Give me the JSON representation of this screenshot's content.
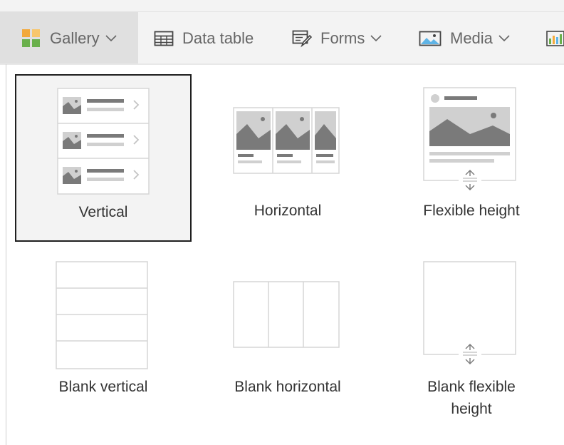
{
  "toolbar": {
    "items": [
      {
        "label": "Gallery",
        "icon": "gallery-icon",
        "has_dropdown": true,
        "active": true
      },
      {
        "label": "Data table",
        "icon": "table-icon",
        "has_dropdown": false,
        "active": false
      },
      {
        "label": "Forms",
        "icon": "form-icon",
        "has_dropdown": true,
        "active": false
      },
      {
        "label": "Media",
        "icon": "image-icon",
        "has_dropdown": true,
        "active": false
      },
      {
        "label": "",
        "icon": "chart-icon",
        "has_dropdown": false,
        "active": false
      }
    ]
  },
  "gallery": {
    "layouts": [
      {
        "label": "Vertical",
        "icon": "vertical-gallery-icon",
        "selected": true
      },
      {
        "label": "Horizontal",
        "icon": "horizontal-gallery-icon",
        "selected": false
      },
      {
        "label": "Flexible height",
        "icon": "flexible-height-gallery-icon",
        "selected": false
      },
      {
        "label": "Blank vertical",
        "icon": "blank-vertical-gallery-icon",
        "selected": false
      },
      {
        "label": "Blank horizontal",
        "icon": "blank-horizontal-gallery-icon",
        "selected": false
      },
      {
        "label_line1": "Blank flexible",
        "label_line2": "height",
        "icon": "blank-flexible-height-gallery-icon",
        "selected": false
      }
    ]
  },
  "colors": {
    "toolbar_bg": "#f3f3f3",
    "active_item_bg": "#e0e0e0",
    "thumbnail_dark": "#7a7a7a",
    "thumbnail_light": "#d0d0d0",
    "selected_border": "#1f1f1f",
    "gallery_icon_orange": "#f2a93b",
    "gallery_icon_green": "#6ab04c"
  }
}
